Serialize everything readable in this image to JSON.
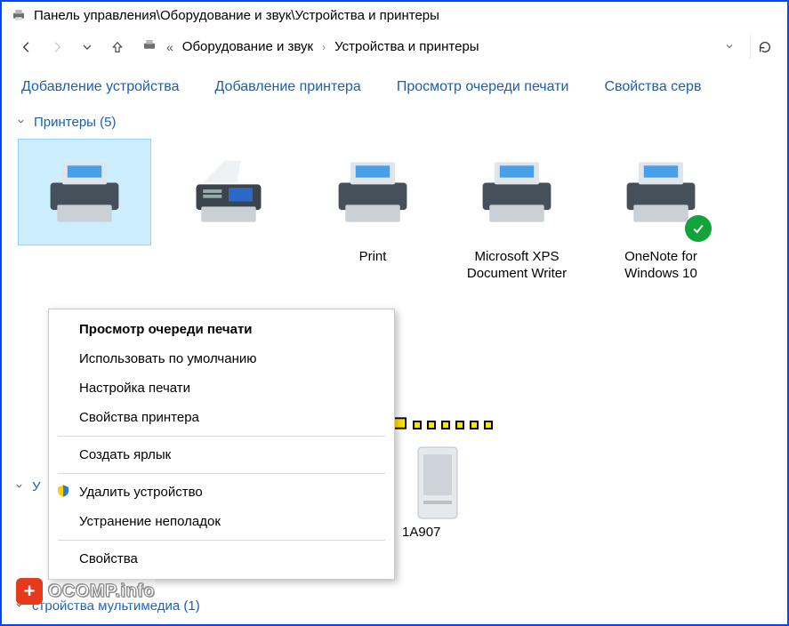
{
  "window": {
    "title": "Панель управления\\Оборудование и звук\\Устройства и принтеры"
  },
  "breadcrumb": {
    "crumb1": "Оборудование и звук",
    "crumb2": "Устройства и принтеры"
  },
  "commands": {
    "add_device": "Добавление устройства",
    "add_printer": "Добавление принтера",
    "view_queue": "Просмотр очереди печати",
    "server_props": "Свойства серв"
  },
  "groups": {
    "printers": {
      "label": "Принтеры (5)"
    },
    "unspecified_prefix": "У",
    "multimedia": {
      "label": "стройства мультимедиа (1)"
    }
  },
  "printers": [
    {
      "name": ""
    },
    {
      "name": ""
    },
    {
      "name": "Print"
    },
    {
      "name": "Microsoft XPS Document Writer"
    },
    {
      "name": "OneNote for Windows 10",
      "default": true
    }
  ],
  "unspecified_item_label": "1A907",
  "context_menu": {
    "view_queue": "Просмотр очереди печати",
    "set_default": "Использовать по умолчанию",
    "print_prefs": "Настройка печати",
    "printer_props": "Свойства принтера",
    "create_shortcut": "Создать ярлык",
    "remove_device": "Удалить устройство",
    "troubleshoot": "Устранение неполадок",
    "properties": "Свойства"
  },
  "watermark": {
    "text": "OCOMP.info"
  }
}
